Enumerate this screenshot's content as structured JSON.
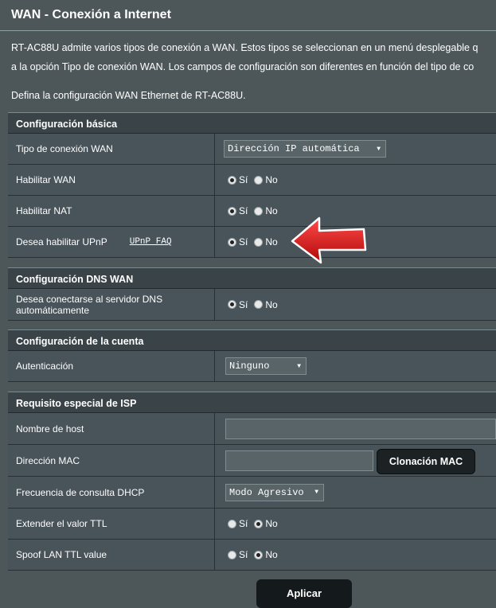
{
  "title": "WAN - Conexión a Internet",
  "desc1": "RT-AC88U admite varios tipos de conexión a WAN. Estos tipos se seleccionan en un menú desplegable q",
  "desc2": "a la opción Tipo de conexión WAN. Los campos de configuración son diferentes en función del tipo de co",
  "desc3": "Defina la configuración WAN Ethernet de RT-AC88U.",
  "yes": "Sí",
  "no": "No",
  "basic": {
    "header": "Configuración básica",
    "wan_type_label": "Tipo de conexión WAN",
    "wan_type_value": "Dirección IP automática",
    "enable_wan_label": "Habilitar WAN",
    "enable_nat_label": "Habilitar NAT",
    "upnp_label": "Desea habilitar UPnP",
    "upnp_faq": "UPnP FAQ"
  },
  "dns": {
    "header": "Configuración DNS WAN",
    "auto_dns_label": "Desea conectarse al servidor DNS automáticamente"
  },
  "account": {
    "header": "Configuración de la cuenta",
    "auth_label": "Autenticación",
    "auth_value": "Ninguno"
  },
  "isp": {
    "header": "Requisito especial de ISP",
    "hostname_label": "Nombre de host",
    "hostname_value": "",
    "mac_label": "Dirección MAC",
    "mac_value": "",
    "mac_clone_button": "Clonación MAC",
    "dhcp_freq_label": "Frecuencia de consulta DHCP",
    "dhcp_freq_value": "Modo Agresivo",
    "ttl_label": "Extender el valor TTL",
    "spoof_ttl_label": "Spoof LAN TTL value"
  },
  "radios": {
    "enable_wan": "yes",
    "enable_nat": "yes",
    "upnp": "yes",
    "auto_dns": "yes",
    "extend_ttl": "no",
    "spoof_ttl": "no"
  },
  "apply_button": "Aplicar",
  "colors": {
    "background": "#4d5659",
    "arrow": "#e01818",
    "button": "#14191b"
  },
  "icons": {
    "annotation_arrow": "left-arrow-icon",
    "dropdown": "caret-down-icon"
  }
}
